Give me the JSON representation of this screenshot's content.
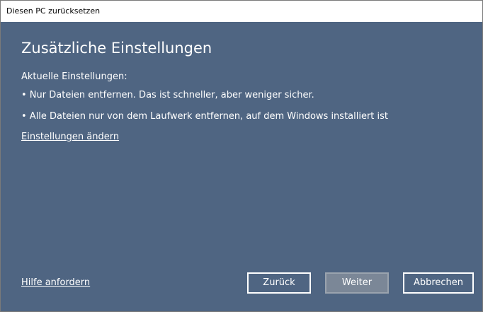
{
  "window": {
    "title": "Diesen PC zurücksetzen"
  },
  "main": {
    "heading": "Zusätzliche Einstellungen",
    "current_settings_label": "Aktuelle Einstellungen:",
    "bullets": [
      "• Nur Dateien entfernen. Das ist schneller, aber weniger sicher.",
      "• Alle Dateien nur von dem Laufwerk entfernen, auf dem Windows installiert ist"
    ],
    "change_settings_link": "Einstellungen ändern"
  },
  "footer": {
    "help_link": "Hilfe anfordern",
    "back_label": "Zurück",
    "next_label": "Weiter",
    "cancel_label": "Abbrechen"
  },
  "colors": {
    "background": "#4f6582",
    "text": "#ffffff",
    "next_button_fill": "#7b8797"
  }
}
